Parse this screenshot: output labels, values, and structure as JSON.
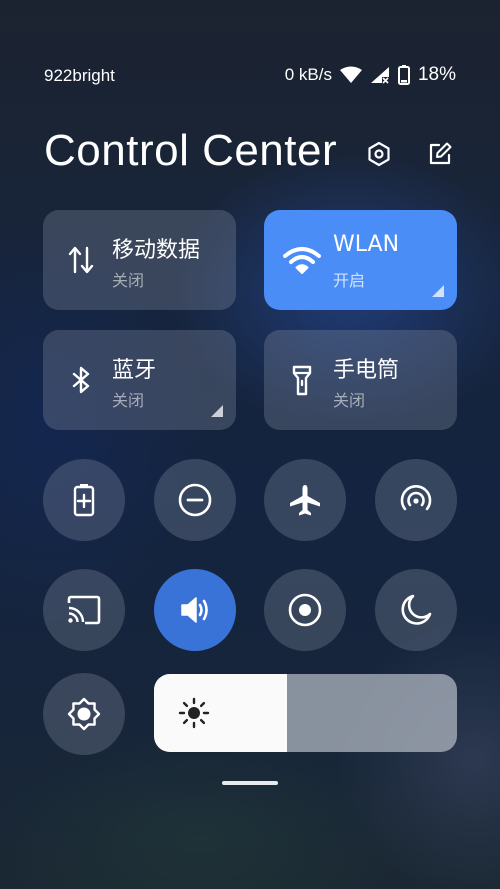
{
  "status_bar": {
    "carrier": "922bright",
    "net_speed": "0 kB/s",
    "battery": "18%"
  },
  "header": {
    "title": "Control Center"
  },
  "tiles": [
    {
      "label": "移动数据",
      "state": "关闭",
      "icon": "mobile-data-icon",
      "active": false
    },
    {
      "label": "WLAN",
      "state": "开启",
      "icon": "wifi-icon",
      "active": true
    },
    {
      "label": "蓝牙",
      "state": "关闭",
      "icon": "bluetooth-icon",
      "active": false
    },
    {
      "label": "手电筒",
      "state": "关闭",
      "icon": "flashlight-icon",
      "active": false
    }
  ],
  "toggles": [
    {
      "icon": "battery-saver-icon",
      "active": false
    },
    {
      "icon": "do-not-disturb-icon",
      "active": false
    },
    {
      "icon": "airplane-icon",
      "active": false
    },
    {
      "icon": "hotspot-icon",
      "active": false
    },
    {
      "icon": "cast-icon",
      "active": false
    },
    {
      "icon": "sound-icon",
      "active": true
    },
    {
      "icon": "screen-record-icon",
      "active": false
    },
    {
      "icon": "dark-mode-icon",
      "active": false
    }
  ],
  "brightness": {
    "auto_icon": "auto-brightness-icon",
    "slider_icon": "sun-icon",
    "level": 0.44
  },
  "colors": {
    "accent": "#4a8df7",
    "toggle_active": "#3a73d8"
  }
}
